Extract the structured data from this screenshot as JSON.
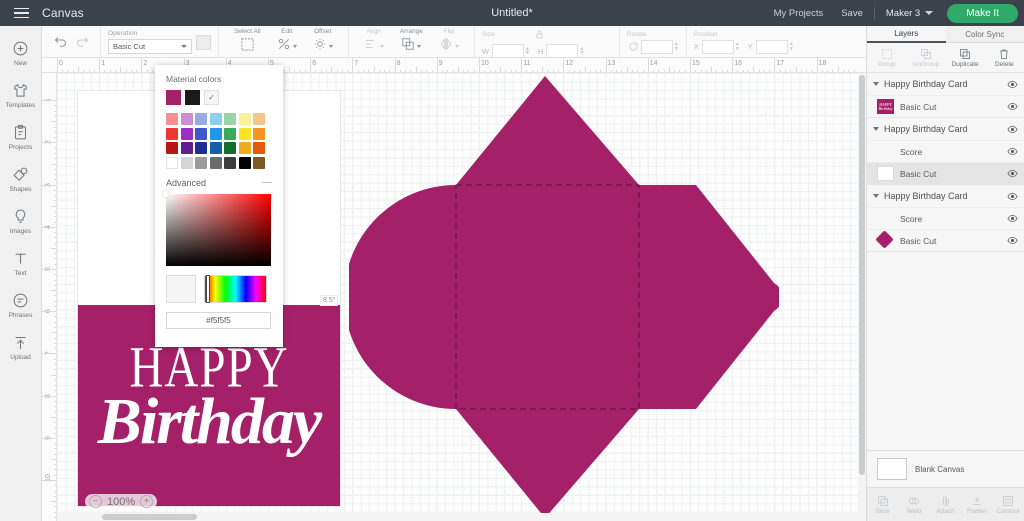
{
  "header": {
    "menu_icon": "hamburger-icon",
    "canvas_label": "Canvas",
    "title": "Untitled*",
    "my_projects": "My Projects",
    "save": "Save",
    "machine": "Maker 3",
    "make_it": "Make It"
  },
  "toolbar": {
    "undo_icon": "undo-icon",
    "redo_icon": "redo-icon",
    "operation_label": "Operation",
    "operation_value": "Basic Cut",
    "select_all": "Select All",
    "edit": "Edit",
    "offset": "Offset",
    "align": "Align",
    "arrange": "Arrange",
    "flip": "Flip",
    "size": "Size",
    "size_w_label": "W",
    "size_h_label": "H",
    "size_w_value": "",
    "size_h_value": "",
    "rotate": "Rotate",
    "rotate_value": "",
    "position": "Position",
    "position_x_label": "X",
    "position_y_label": "Y",
    "position_x_value": "",
    "position_y_value": ""
  },
  "sidebar": {
    "items": [
      {
        "label": "New",
        "icon": "plus-circle-icon"
      },
      {
        "label": "Templates",
        "icon": "shirt-icon"
      },
      {
        "label": "Projects",
        "icon": "clipboard-icon"
      },
      {
        "label": "Shapes",
        "icon": "shapes-icon"
      },
      {
        "label": "Images",
        "icon": "lightbulb-icon"
      },
      {
        "label": "Text",
        "icon": "text-t-icon"
      },
      {
        "label": "Phrases",
        "icon": "speech-bubble-icon"
      },
      {
        "label": "Upload",
        "icon": "upload-arrow-icon"
      }
    ]
  },
  "picker": {
    "title": "Material colors",
    "primary_swatches": [
      "#a42169",
      "#1a1a1a",
      "#f5f5f5"
    ],
    "selected_swatch_index": 2,
    "check_icon": "check-icon",
    "grid": [
      [
        "#f59090",
        "#cd8fd4",
        "#9aa9e0",
        "#8ccdf0",
        "#9ad3a4",
        "#fbf09a",
        "#f8c48d"
      ],
      [
        "#f03434",
        "#9b2fc4",
        "#3f58c8",
        "#2296e8",
        "#3aab5c",
        "#f7e423",
        "#f79421"
      ],
      [
        "#b81717",
        "#5c2090",
        "#1e2f91",
        "#145fa8",
        "#176b2d",
        "#edad1c",
        "#e4590e"
      ],
      [
        "#ffffff",
        "#d5d5d5",
        "#9b9b9b",
        "#6b6b6b",
        "#3d3d3d",
        "#000000",
        "#7a5a20"
      ]
    ],
    "advanced_label": "Advanced",
    "minimize_icon": "minus-icon",
    "hue": "#ff0000",
    "current_color": "#f5f5f5",
    "hex_value": "#f5f5f5"
  },
  "canvas": {
    "ruler_h": [
      "0",
      "1",
      "2",
      "3",
      "4",
      "5",
      "6",
      "7",
      "8",
      "9",
      "10",
      "11",
      "12",
      "13",
      "14",
      "15",
      "16",
      "17",
      "18"
    ],
    "ruler_v": [
      "1",
      "2",
      "3",
      "4",
      "5",
      "6",
      "7",
      "8",
      "9",
      "10"
    ],
    "zoom_out_icon": "minus-circle-icon",
    "zoom_in_icon": "plus-circle-icon",
    "zoom_value": "100%",
    "dimension_badge": "8.5\"",
    "card_text_line1": "HAPPY",
    "card_text_line2": "Birthday",
    "card_color": "#a42169",
    "envelope_color": "#a42169"
  },
  "right_panel": {
    "tabs": [
      {
        "label": "Layers",
        "active": true
      },
      {
        "label": "Color Sync",
        "active": false
      }
    ],
    "actions": [
      {
        "label": "Group",
        "icon": "group-icon",
        "disabled": true
      },
      {
        "label": "UnGroup",
        "icon": "ungroup-icon",
        "disabled": true
      },
      {
        "label": "Duplicate",
        "icon": "duplicate-icon",
        "disabled": false
      },
      {
        "label": "Delete",
        "icon": "trash-icon",
        "disabled": false
      }
    ],
    "groups": [
      {
        "name": "Happy Birthday Card",
        "caret_icon": "caret-down-icon",
        "eye_icon": "eye-icon",
        "rows": [
          {
            "label": "Basic Cut",
            "thumb": "art",
            "selected": false,
            "eye_icon": "eye-icon"
          }
        ]
      },
      {
        "name": "Happy Birthday Card",
        "caret_icon": "caret-down-icon",
        "eye_icon": "eye-icon",
        "rows": [
          {
            "label": "Score",
            "thumb": "none",
            "selected": false,
            "eye_icon": "eye-icon"
          },
          {
            "label": "Basic Cut",
            "thumb": "white",
            "selected": true,
            "eye_icon": "eye-icon"
          }
        ]
      },
      {
        "name": "Happy Birthday Card",
        "caret_icon": "caret-down-icon",
        "eye_icon": "eye-icon",
        "rows": [
          {
            "label": "Score",
            "thumb": "none",
            "selected": false,
            "eye_icon": "eye-icon"
          },
          {
            "label": "Basic Cut",
            "thumb": "diamond",
            "selected": false,
            "eye_icon": "eye-icon"
          }
        ]
      }
    ],
    "blank_canvas_label": "Blank Canvas",
    "tools": [
      {
        "label": "Slice",
        "icon": "slice-icon"
      },
      {
        "label": "Weld",
        "icon": "weld-icon"
      },
      {
        "label": "Attach",
        "icon": "paperclip-icon"
      },
      {
        "label": "Flatten",
        "icon": "flatten-icon"
      },
      {
        "label": "Contour",
        "icon": "contour-icon"
      }
    ]
  }
}
